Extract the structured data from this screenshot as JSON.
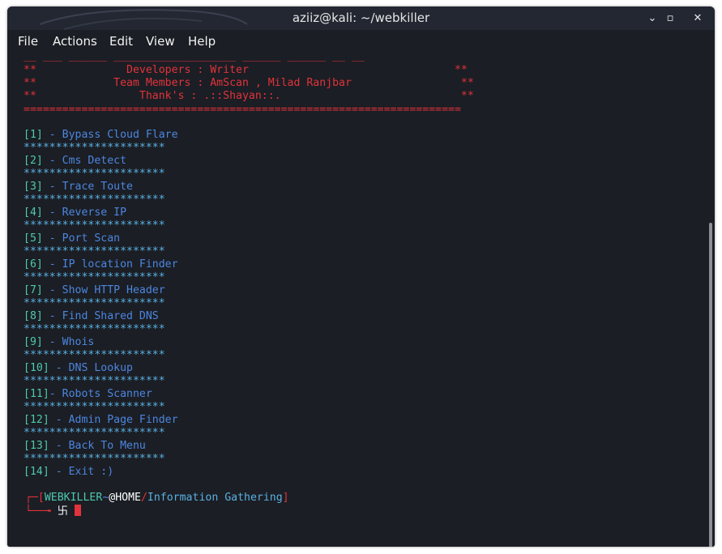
{
  "window": {
    "title": "aziiz@kali: ~/webkiller",
    "minimize_glyph": "⌄",
    "maximize_glyph": "▫",
    "close_glyph": "✕"
  },
  "menu": {
    "file": "File",
    "actions": "Actions",
    "edit": "Edit",
    "view": "View",
    "help": "Help"
  },
  "banner": {
    "top_line": "__ ___ ______ ___________________ ______ ______ __ __",
    "developers": "**              Developers : Writer                                **",
    "team": "**            Team Members : AmScan , Milad Ranjbar                 **",
    "thanks": "**                Thank's : .::Shayan::.                            **",
    "rule": "===================================================================="
  },
  "options": [
    {
      "num": "[1]",
      "label": " - Bypass Cloud Flare"
    },
    {
      "num": "[2]",
      "label": " - Cms Detect"
    },
    {
      "num": "[3]",
      "label": " - Trace Toute"
    },
    {
      "num": "[4]",
      "label": " - Reverse IP"
    },
    {
      "num": "[5]",
      "label": " - Port Scan"
    },
    {
      "num": "[6]",
      "label": " - IP location Finder"
    },
    {
      "num": "[7]",
      "label": " - Show HTTP Header"
    },
    {
      "num": "[8]",
      "label": " - Find Shared DNS"
    },
    {
      "num": "[9]",
      "label": " - Whois"
    },
    {
      "num": "[10]",
      "label": " - DNS Lookup"
    },
    {
      "num": "[11]",
      "label": "- Robots Scanner"
    },
    {
      "num": "[12]",
      "label": " - Admin Page Finder"
    },
    {
      "num": "[13]",
      "label": " - Back To Menu"
    },
    {
      "num": "[14]",
      "label": " - Exit :)"
    }
  ],
  "separator": "**********************",
  "prompt": {
    "corner_top": "┌─",
    "open_bracket": "[",
    "name": "WEBKILLER",
    "tilde": "~",
    "at_home": "@HOME",
    "slash": "/",
    "section": "Information Gathering",
    "close_bracket": "]",
    "corner_bottom": "└──╼",
    "symbol": "卐"
  },
  "colors": {
    "background": "#1b1e24",
    "red": "#e0333b",
    "cyan": "#5ab0e3",
    "blue": "#4c86e0",
    "teal": "#4ec9b0"
  }
}
